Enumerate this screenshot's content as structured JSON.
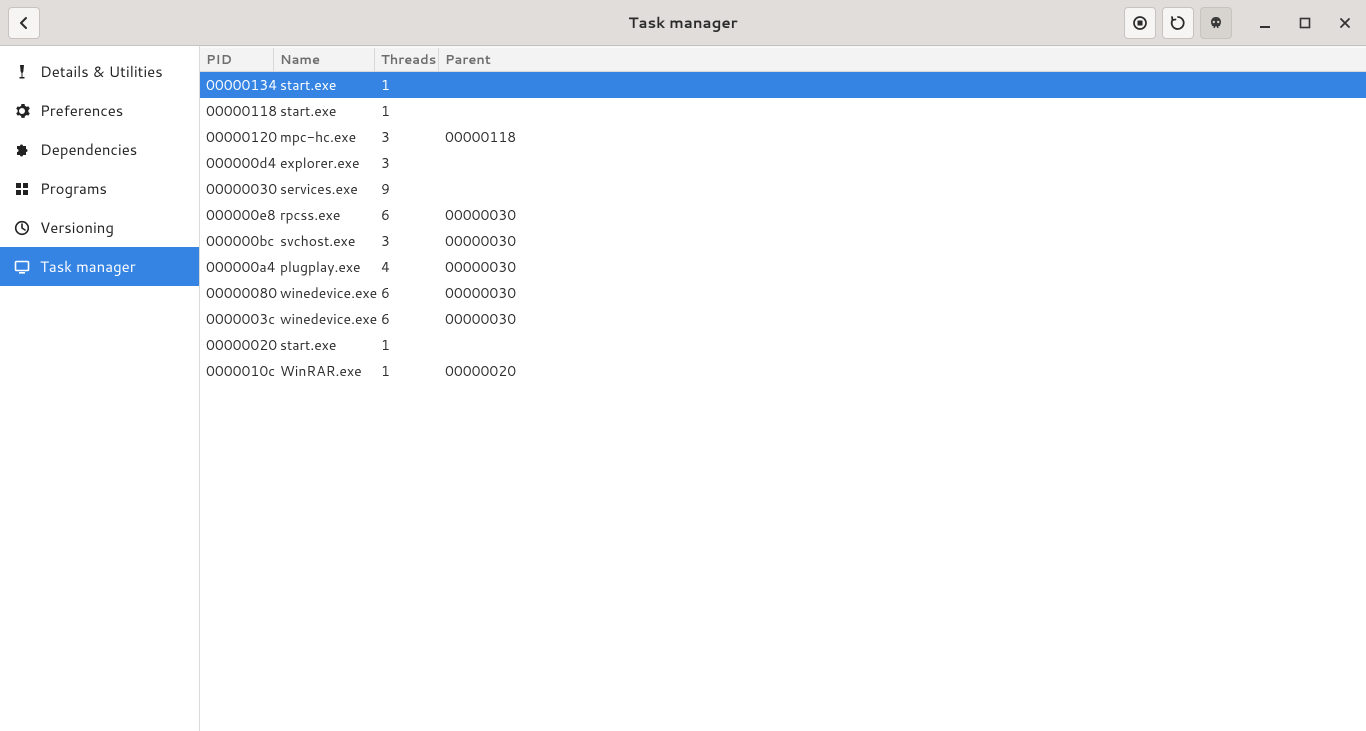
{
  "title": "Task manager",
  "sidebar": {
    "items": [
      {
        "label": "Details & Utilities",
        "icon": "wine-icon",
        "selected": false
      },
      {
        "label": "Preferences",
        "icon": "gear-icon",
        "selected": false
      },
      {
        "label": "Dependencies",
        "icon": "puzzle-icon",
        "selected": false
      },
      {
        "label": "Programs",
        "icon": "programs-icon",
        "selected": false
      },
      {
        "label": "Versioning",
        "icon": "clock-icon",
        "selected": false
      },
      {
        "label": "Task manager",
        "icon": "monitor-icon",
        "selected": true
      }
    ]
  },
  "table": {
    "columns": {
      "pid": "PID",
      "name": "Name",
      "threads": "Threads",
      "parent": "Parent"
    },
    "rows": [
      {
        "pid": "00000134",
        "name": "start.exe",
        "threads": "1",
        "parent": "",
        "selected": true
      },
      {
        "pid": "00000118",
        "name": "start.exe",
        "threads": "1",
        "parent": "",
        "selected": false
      },
      {
        "pid": "00000120",
        "name": "mpc-hc.exe",
        "threads": "3",
        "parent": "00000118",
        "selected": false
      },
      {
        "pid": "000000d4",
        "name": "explorer.exe",
        "threads": "3",
        "parent": "",
        "selected": false
      },
      {
        "pid": "00000030",
        "name": "services.exe",
        "threads": "9",
        "parent": "",
        "selected": false
      },
      {
        "pid": "000000e8",
        "name": "rpcss.exe",
        "threads": "6",
        "parent": "00000030",
        "selected": false
      },
      {
        "pid": "000000bc",
        "name": "svchost.exe",
        "threads": "3",
        "parent": "00000030",
        "selected": false
      },
      {
        "pid": "000000a4",
        "name": "plugplay.exe",
        "threads": "4",
        "parent": "00000030",
        "selected": false
      },
      {
        "pid": "00000080",
        "name": "winedevice.exe",
        "threads": "6",
        "parent": "00000030",
        "selected": false
      },
      {
        "pid": "0000003c",
        "name": "winedevice.exe",
        "threads": "6",
        "parent": "00000030",
        "selected": false
      },
      {
        "pid": "00000020",
        "name": "start.exe",
        "threads": "1",
        "parent": "",
        "selected": false
      },
      {
        "pid": "0000010c",
        "name": "WinRAR.exe",
        "threads": "1",
        "parent": "00000020",
        "selected": false
      }
    ]
  }
}
